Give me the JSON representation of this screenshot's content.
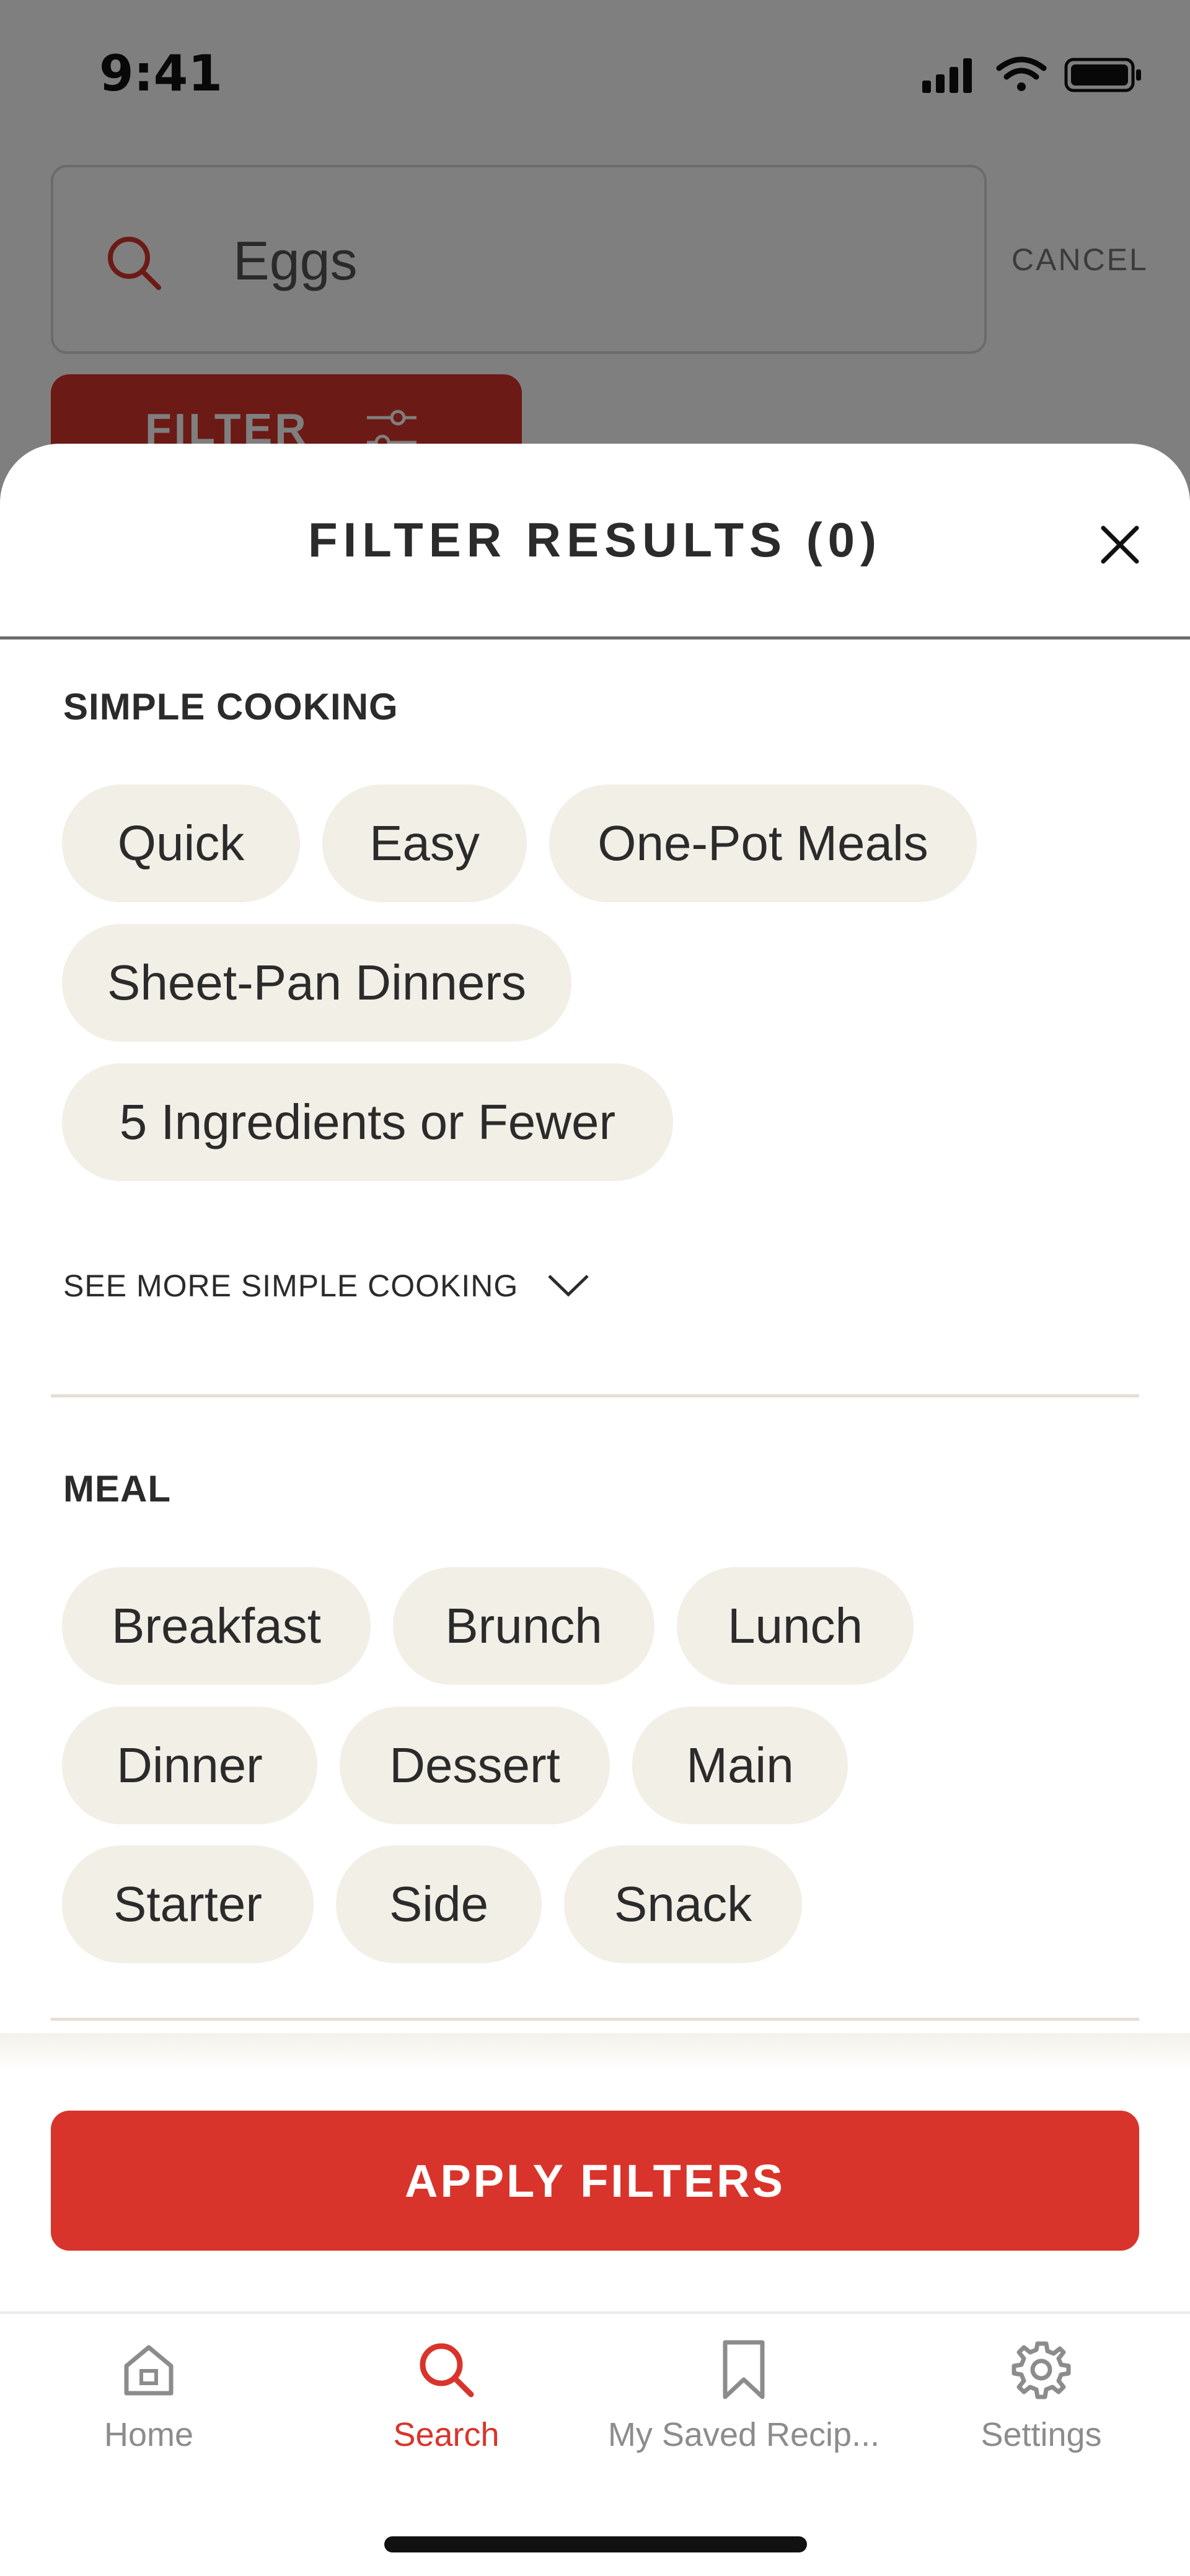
{
  "status_bar": {
    "time": "9:41"
  },
  "background": {
    "search": {
      "value": "Eggs"
    },
    "cancel_label": "CANCEL",
    "filter_label": "FILTER"
  },
  "sheet": {
    "title": "FILTER RESULTS (0)",
    "sections": [
      {
        "title": "SIMPLE COOKING",
        "chips": [
          "Quick",
          "Easy",
          "One-Pot Meals",
          "Sheet-Pan Dinners",
          "5 Ingredients or Fewer"
        ],
        "see_more": "SEE MORE SIMPLE COOKING"
      },
      {
        "title": "MEAL",
        "chips": [
          "Breakfast",
          "Brunch",
          "Lunch",
          "Dinner",
          "Dessert",
          "Main",
          "Starter",
          "Side",
          "Snack"
        ]
      }
    ],
    "apply_label": "APPLY FILTERS"
  },
  "tab_bar": {
    "tabs": [
      {
        "label": "Home",
        "icon": "home-icon",
        "active": false
      },
      {
        "label": "Search",
        "icon": "search-icon",
        "active": true
      },
      {
        "label": "My Saved Recip...",
        "icon": "bookmark-icon",
        "active": false
      },
      {
        "label": "Settings",
        "icon": "gear-icon",
        "active": false
      }
    ]
  },
  "colors": {
    "accent": "#d9342b",
    "chip_bg": "#f2efe7",
    "text": "#2b2b2b",
    "tab_inactive": "#8c8c8c"
  }
}
